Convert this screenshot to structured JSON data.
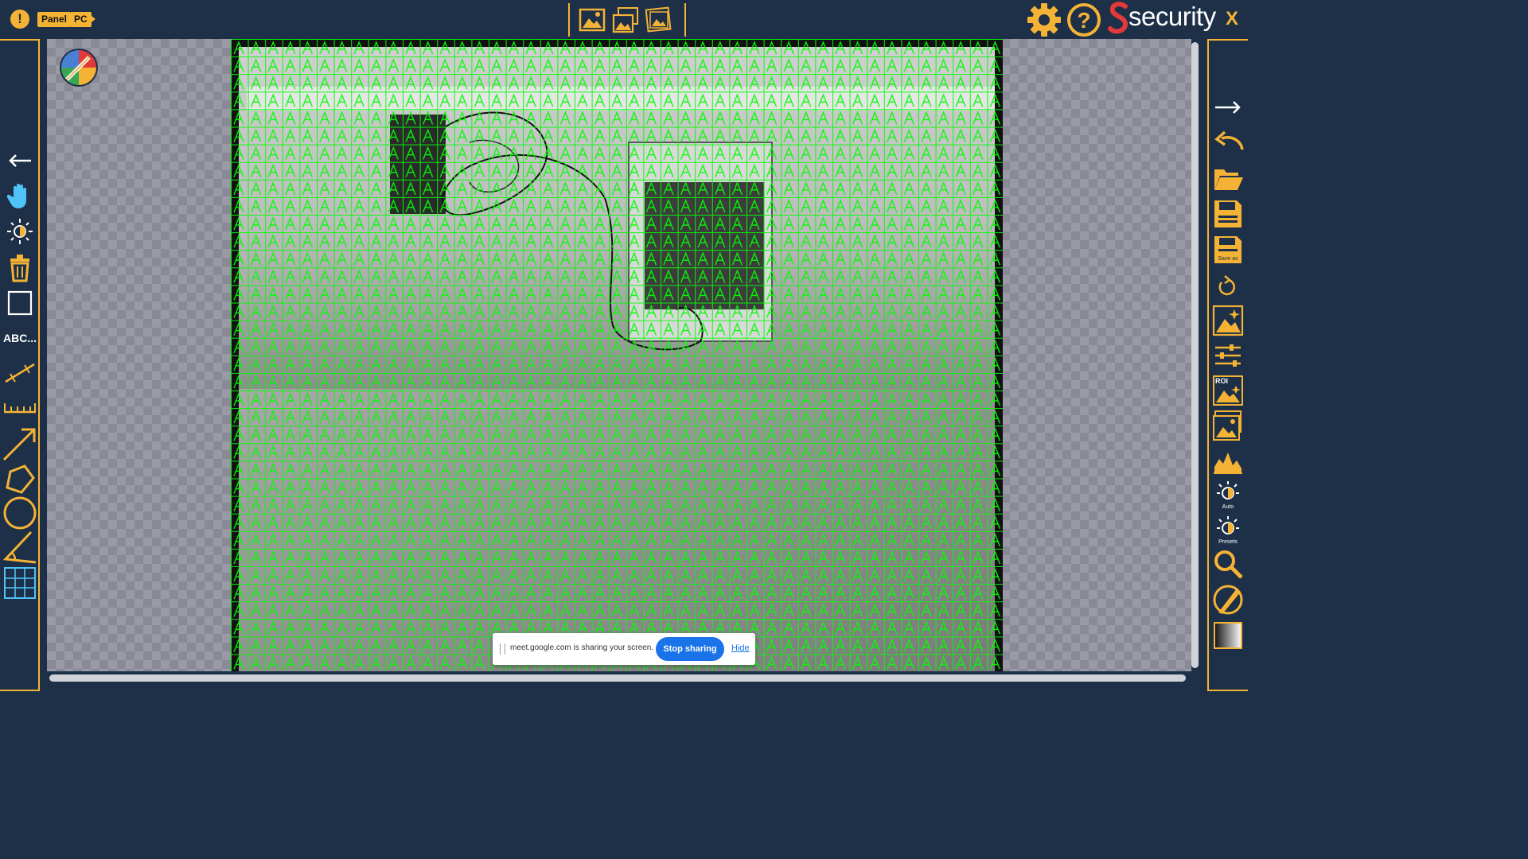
{
  "header": {
    "panel_label": "Panel",
    "pc_label": "PC",
    "warning_glyph": "!",
    "brand_word": "security",
    "close_label": "X",
    "center_icons": [
      "image-icon",
      "images-compare-icon",
      "image-frame-icon"
    ]
  },
  "left_toolbar": {
    "tools": [
      "back-arrow-icon",
      "hand-pan-icon",
      "brightness-icon",
      "delete-icon",
      "rectangle-icon",
      "text-tool",
      "line-icon",
      "ruler-icon",
      "arrow-icon",
      "polygon-icon",
      "circle-icon",
      "angle-icon",
      "grid-icon"
    ],
    "text_tool_label": "ABC..."
  },
  "right_toolbar": {
    "tools": [
      "forward-arrow-icon",
      "undo-icon",
      "open-folder-icon",
      "save-icon",
      "save-as-icon",
      "rotate-icon",
      "image-enhance-icon",
      "sliders-icon",
      "roi-icon",
      "image-icon",
      "histogram-icon",
      "auto-brightness-icon",
      "presets-brightness-icon",
      "zoom-icon",
      "pen-circle-icon",
      "gradient-icon"
    ],
    "save_as_caption": "Save as",
    "roi_caption": "ROI",
    "auto_caption": "Auto",
    "presets_caption": "Presets"
  },
  "colors": {
    "background": "#1d3048",
    "accent": "#f5b335",
    "grid_overlay": "#00ff00",
    "share_button": "#1a73e8"
  },
  "screen_share": {
    "message": "meet.google.com is sharing your screen.",
    "stop_label": "Stop sharing",
    "hide_label": "Hide"
  }
}
